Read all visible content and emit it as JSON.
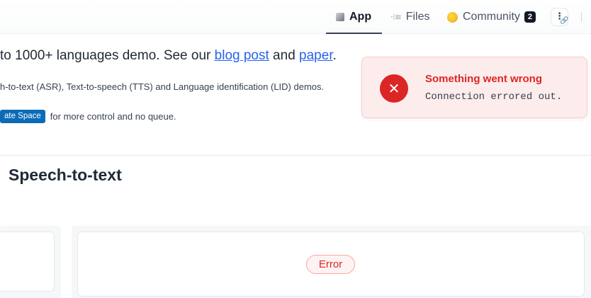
{
  "nav": {
    "tabs": [
      {
        "label": "App",
        "icon": "cube-icon",
        "active": true
      },
      {
        "label": "Files",
        "icon": "files-icon"
      },
      {
        "label": "Community",
        "icon": "hand-icon",
        "badge": "2"
      }
    ],
    "more_symbol": "⋮",
    "link_symbol": "🔗"
  },
  "intro": {
    "line1_prefix": "to 1000+ languages demo. See our ",
    "blog_link": "blog post",
    "line1_mid": " and ",
    "paper_link": "paper",
    "line1_suffix": ".",
    "line2": "h-to-text (ASR), Text-to-speech (TTS) and Language identification (LID) demos.",
    "duplicate_button": "ate Space",
    "line3_suffix": "for more control and no queue."
  },
  "section": {
    "title": "Speech-to-text"
  },
  "status": {
    "error_label": "Error"
  },
  "toast": {
    "icon_symbol": "✕",
    "title": "Something went wrong",
    "message": "Connection errored out."
  },
  "colors": {
    "accent_link": "#2563eb",
    "error": "#dc2626",
    "toast_bg": "#fdecec",
    "duplicate_button_bg": "#0b6bb6"
  }
}
